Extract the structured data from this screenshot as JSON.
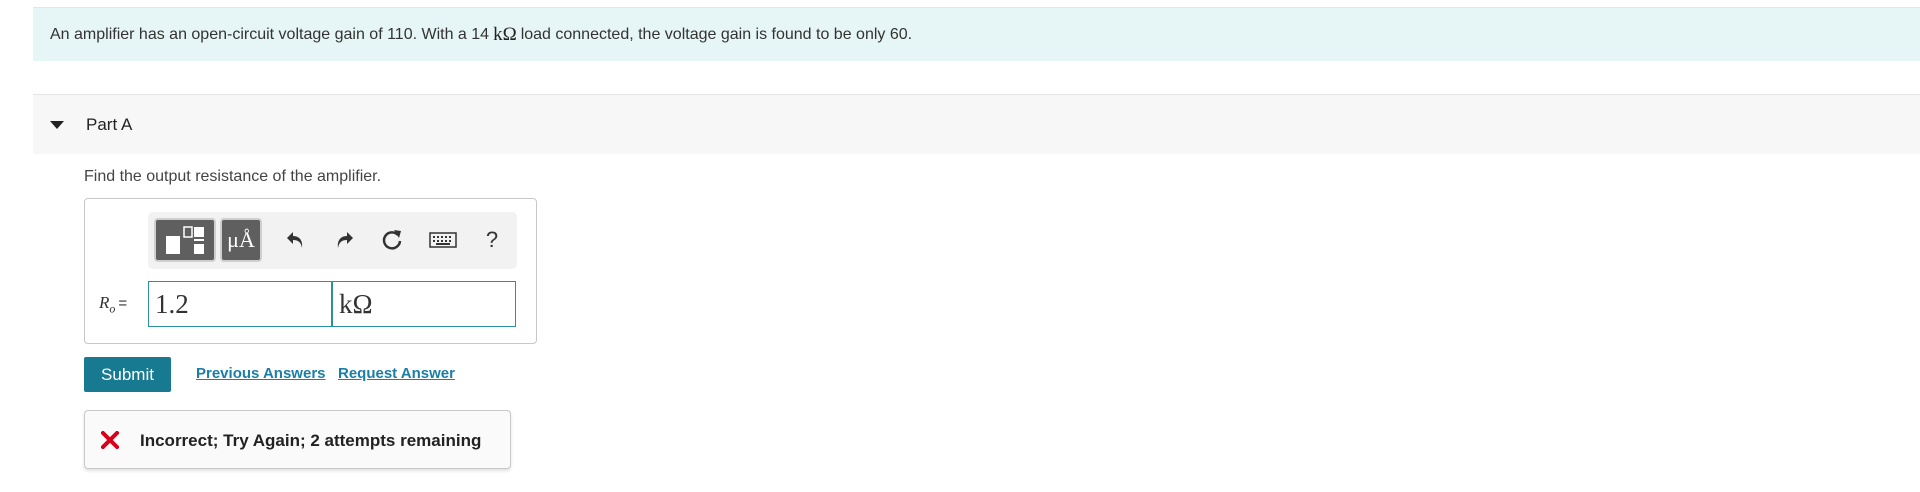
{
  "intro": {
    "text_before": "An amplifier has an open-circuit voltage gain of 110. With a 14",
    "load_unit": "kΩ",
    "text_after": "load connected, the voltage gain is found to be only 60."
  },
  "part": {
    "title": "Part A",
    "question": "Find the output resistance of the amplifier."
  },
  "toolbar": {
    "units_label": "μÅ",
    "help_label": "?",
    "icons": [
      "templates-icon",
      "units-icon",
      "undo-icon",
      "redo-icon",
      "reset-icon",
      "keyboard-icon",
      "help-icon"
    ]
  },
  "answer": {
    "variable": "R",
    "subscript": "o",
    "equals": "=",
    "value": "1.2",
    "unit": "kΩ"
  },
  "actions": {
    "submit_label": "Submit",
    "previous_answers_label": "Previous Answers",
    "request_answer_label": "Request Answer"
  },
  "feedback": {
    "message": "Incorrect; Try Again; 2 attempts remaining",
    "status_color": "#d9001b"
  },
  "colors": {
    "intro_bg": "#e6f5f5",
    "accent": "#187a91",
    "link": "#1a7ea8"
  }
}
